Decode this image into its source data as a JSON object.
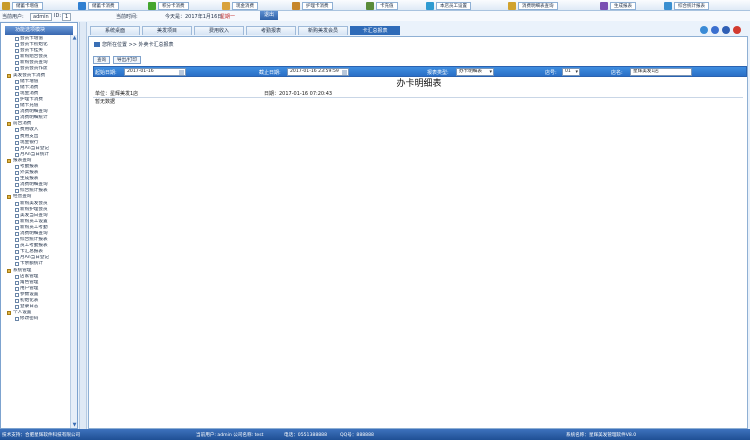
{
  "toolbar": {
    "buttons": [
      {
        "label": "储蓄卡增值",
        "color": "#c89b2a"
      },
      {
        "label": "储蓄卡消费",
        "color": "#2f7fd1"
      },
      {
        "label": "积分卡消费",
        "color": "#43a52f"
      },
      {
        "label": "现金消费",
        "color": "#d9a23b"
      },
      {
        "label": "护理卡消费",
        "color": "#c6862b"
      },
      {
        "label": "卡充值",
        "color": "#5a8c3a"
      },
      {
        "label": "本店员工设置",
        "color": "#2f9bd1"
      },
      {
        "label": "消费明细表查询",
        "color": "#d1a32f"
      },
      {
        "label": "生成报表",
        "color": "#7a4fb2"
      },
      {
        "label": "综合统计报表",
        "color": "#3a8fd0"
      }
    ]
  },
  "infobar": {
    "user_label": "当前用户:",
    "user_value": "admin",
    "id_label": "ID:",
    "id_value": "1",
    "time_label": "当前时间:",
    "date_text": "今天是：2017年1月16日",
    "weekday": "星期一",
    "logout_label": "退出"
  },
  "sidebar": {
    "title": "功能选项模块",
    "tree": [
      {
        "type": "item",
        "label": "会员卡增值"
      },
      {
        "type": "item",
        "label": "会员卡初始化"
      },
      {
        "type": "item",
        "label": "会员卡挂失"
      },
      {
        "type": "item",
        "label": "新购组合会员"
      },
      {
        "type": "item",
        "label": "新购会员查询"
      },
      {
        "type": "item",
        "label": "会员会员作废"
      },
      {
        "type": "group",
        "label": "美发会员卡消费"
      },
      {
        "type": "item",
        "label": "储卡增值"
      },
      {
        "type": "item",
        "label": "储卡消费"
      },
      {
        "type": "item",
        "label": "现金消费"
      },
      {
        "type": "item",
        "label": "护理卡消费"
      },
      {
        "type": "item",
        "label": "储卡充值"
      },
      {
        "type": "item",
        "label": "消费明细查询"
      },
      {
        "type": "item",
        "label": "消费明细统计"
      },
      {
        "type": "group",
        "label": "前台消费"
      },
      {
        "type": "item",
        "label": "费用收入"
      },
      {
        "type": "item",
        "label": "费用支出"
      },
      {
        "type": "item",
        "label": "现金银行"
      },
      {
        "type": "item",
        "label": "月An当日登记"
      },
      {
        "type": "item",
        "label": "月An当日统计"
      },
      {
        "type": "group",
        "label": "报表查询"
      },
      {
        "type": "item",
        "label": "考勤报表"
      },
      {
        "type": "item",
        "label": "外卖报表"
      },
      {
        "type": "item",
        "label": "生成报表"
      },
      {
        "type": "item",
        "label": "消费明细查询"
      },
      {
        "type": "item",
        "label": "综合统计报表"
      },
      {
        "type": "group",
        "label": "经营查询"
      },
      {
        "type": "item",
        "label": "新购美发会员"
      },
      {
        "type": "item",
        "label": "新购护理会员"
      },
      {
        "type": "item",
        "label": "美发当日查询"
      },
      {
        "type": "item",
        "label": "新购员工设置"
      },
      {
        "type": "item",
        "label": "新购员工考勤"
      },
      {
        "type": "item",
        "label": "消费明细查询"
      },
      {
        "type": "item",
        "label": "综合统计报表"
      },
      {
        "type": "item",
        "label": "员工考勤报表"
      },
      {
        "type": "item",
        "label": "卡汇总报表"
      },
      {
        "type": "item",
        "label": "月An当日登记"
      },
      {
        "type": "item",
        "label": "卡余额统计"
      },
      {
        "type": "group",
        "label": "系统管理"
      },
      {
        "type": "item",
        "label": "店家管理"
      },
      {
        "type": "item",
        "label": "角色管理"
      },
      {
        "type": "item",
        "label": "用户管理"
      },
      {
        "type": "item",
        "label": "参数设置"
      },
      {
        "type": "item",
        "label": "初始化表"
      },
      {
        "type": "item",
        "label": "登录日志"
      },
      {
        "type": "group",
        "label": "个人设置"
      },
      {
        "type": "item",
        "label": "修改密码"
      }
    ]
  },
  "tabs": [
    {
      "label": "系统桌面",
      "active": false
    },
    {
      "label": "美发项目",
      "active": false
    },
    {
      "label": "费用收入",
      "active": false
    },
    {
      "label": "考勤报表",
      "active": false
    },
    {
      "label": "新购美发会员",
      "active": false
    },
    {
      "label": "卡汇总报表",
      "active": true
    }
  ],
  "main": {
    "breadcrumb": "您所在位置 >> 外卖卡汇总报表",
    "subtabs": [
      "查询",
      "导出/打印"
    ],
    "filter": {
      "start_label": "起始日期:",
      "start_value": "2017-01-16",
      "end_label": "截止日期:",
      "end_value": "2017-01-16 23:59:59",
      "type_label": "报表类型:",
      "type_value": "办卡明细表",
      "shop_label": "店号:",
      "shop_value": "01",
      "name_label": "店名:",
      "name_value": "星辉美发1店"
    },
    "report_title": "办卡明细表",
    "unit_label": "单位：星辉美发1店",
    "date_label": "日期：2017-01-16 07:20:43",
    "no_data": "暂无数据"
  },
  "statusbar": {
    "tech": "技术支持：合肥星辉软件科技有限公司",
    "user": "当前用户: admin  公司名称: test",
    "phone": "电话：0551388888",
    "qq": "QQ号：888888",
    "system": "系统名称：星辉美发管理软件V8.0"
  }
}
